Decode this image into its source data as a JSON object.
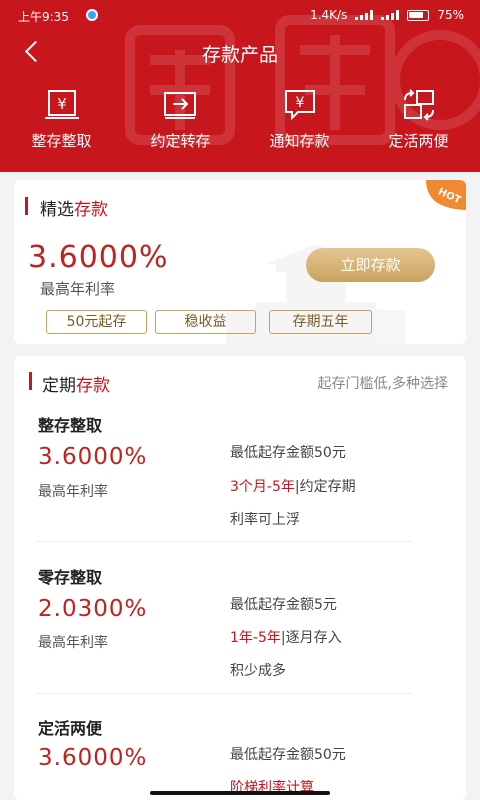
{
  "status": {
    "time": "上午9:35",
    "speed": "1.4K/s",
    "battery": "75%"
  },
  "nav": {
    "title": "存款产品"
  },
  "quick_actions": [
    {
      "label": "整存整取",
      "icon": "yen-doc-icon"
    },
    {
      "label": "约定转存",
      "icon": "transfer-icon"
    },
    {
      "label": "通知存款",
      "icon": "yen-message-icon"
    },
    {
      "label": "定活两便",
      "icon": "swap-icon"
    }
  ],
  "featured": {
    "title_prefix": "精选",
    "title_highlight": "存款",
    "badge": "HOT",
    "rate": "3.6000%",
    "rate_label": "最高年利率",
    "button": "立即存款",
    "tags": [
      "50元起存",
      "稳收益",
      "存期五年"
    ]
  },
  "fixed": {
    "title_prefix": "定期",
    "title_highlight": "存款",
    "subtitle": "起存门槛低,多种选择",
    "products": [
      {
        "name": "整存整取",
        "rate": "3.6000%",
        "rate_label": "最高年利率",
        "line1": "最低起存金额50元",
        "line2_highlight": "3个月-5年",
        "line2_rest": "|约定存期",
        "line3": "利率可上浮"
      },
      {
        "name": "零存整取",
        "rate": "2.0300%",
        "rate_label": "最高年利率",
        "line1": "最低起存金额5元",
        "line2_highlight": "1年-5年",
        "line2_rest": "|逐月存入",
        "line3": "积少成多"
      },
      {
        "name": "定活两便",
        "rate": "3.6000%",
        "line1": "最低起存金额50元",
        "line2_highlight": "阶梯利率计算"
      }
    ]
  },
  "colors": {
    "brand_red": "#c8161d",
    "gold": "#c9a261"
  }
}
